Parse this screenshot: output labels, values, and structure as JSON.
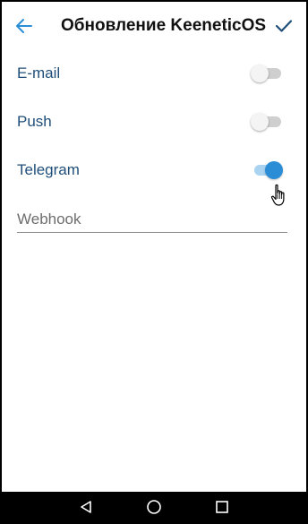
{
  "header": {
    "title": "Обновление KeeneticOS",
    "back_icon": "arrow-left-icon",
    "confirm_icon": "checkmark-icon"
  },
  "notifications": [
    {
      "label": "E-mail",
      "enabled": false
    },
    {
      "label": "Push",
      "enabled": false
    },
    {
      "label": "Telegram",
      "enabled": true
    }
  ],
  "webhook": {
    "placeholder": "Webhook",
    "value": ""
  },
  "navbar": {
    "icons": [
      "back-triangle-icon",
      "home-circle-icon",
      "recents-square-icon"
    ]
  },
  "colors": {
    "accent": "#2b8dd6",
    "label": "#1f4e79",
    "background": "#ffffff",
    "navbar": "#000000"
  }
}
